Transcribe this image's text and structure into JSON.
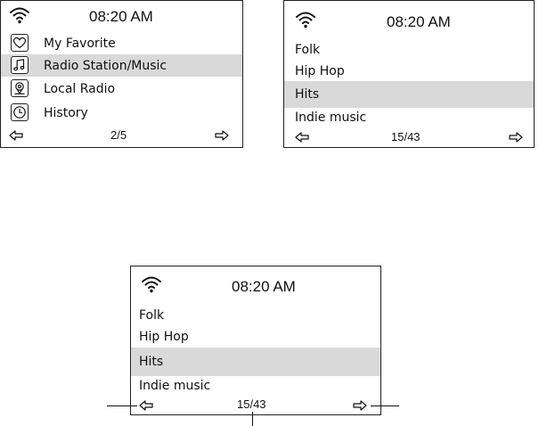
{
  "screens": [
    {
      "time": "08:20 AM",
      "menu": [
        {
          "label": "My Favorite",
          "icon": "heart-icon",
          "selected": false
        },
        {
          "label": "Radio Station/Music",
          "icon": "music-note-icon",
          "selected": true
        },
        {
          "label": "Local Radio",
          "icon": "location-pin-icon",
          "selected": false
        },
        {
          "label": "History",
          "icon": "clock-icon",
          "selected": false
        }
      ],
      "page_indicator": "2/5"
    },
    {
      "time": "08:20 AM",
      "genres": [
        {
          "label": "Folk",
          "selected": false
        },
        {
          "label": "Hip Hop",
          "selected": false
        },
        {
          "label": "Hits",
          "selected": true
        },
        {
          "label": "Indie music",
          "selected": false
        }
      ],
      "page_indicator": "15/43"
    },
    {
      "time": "08:20 AM",
      "genres": [
        {
          "label": "Folk",
          "selected": false
        },
        {
          "label": "Hip Hop",
          "selected": false
        },
        {
          "label": "Hits",
          "selected": true
        },
        {
          "label": "Indie music",
          "selected": false
        }
      ],
      "page_indicator": "15/43"
    }
  ],
  "icons": {
    "signal": "wifi-icon",
    "previous": "left-arrow-icon",
    "next": "right-arrow-icon"
  },
  "colors": {
    "selection": "#d9d9d9",
    "frame": "#222222"
  }
}
